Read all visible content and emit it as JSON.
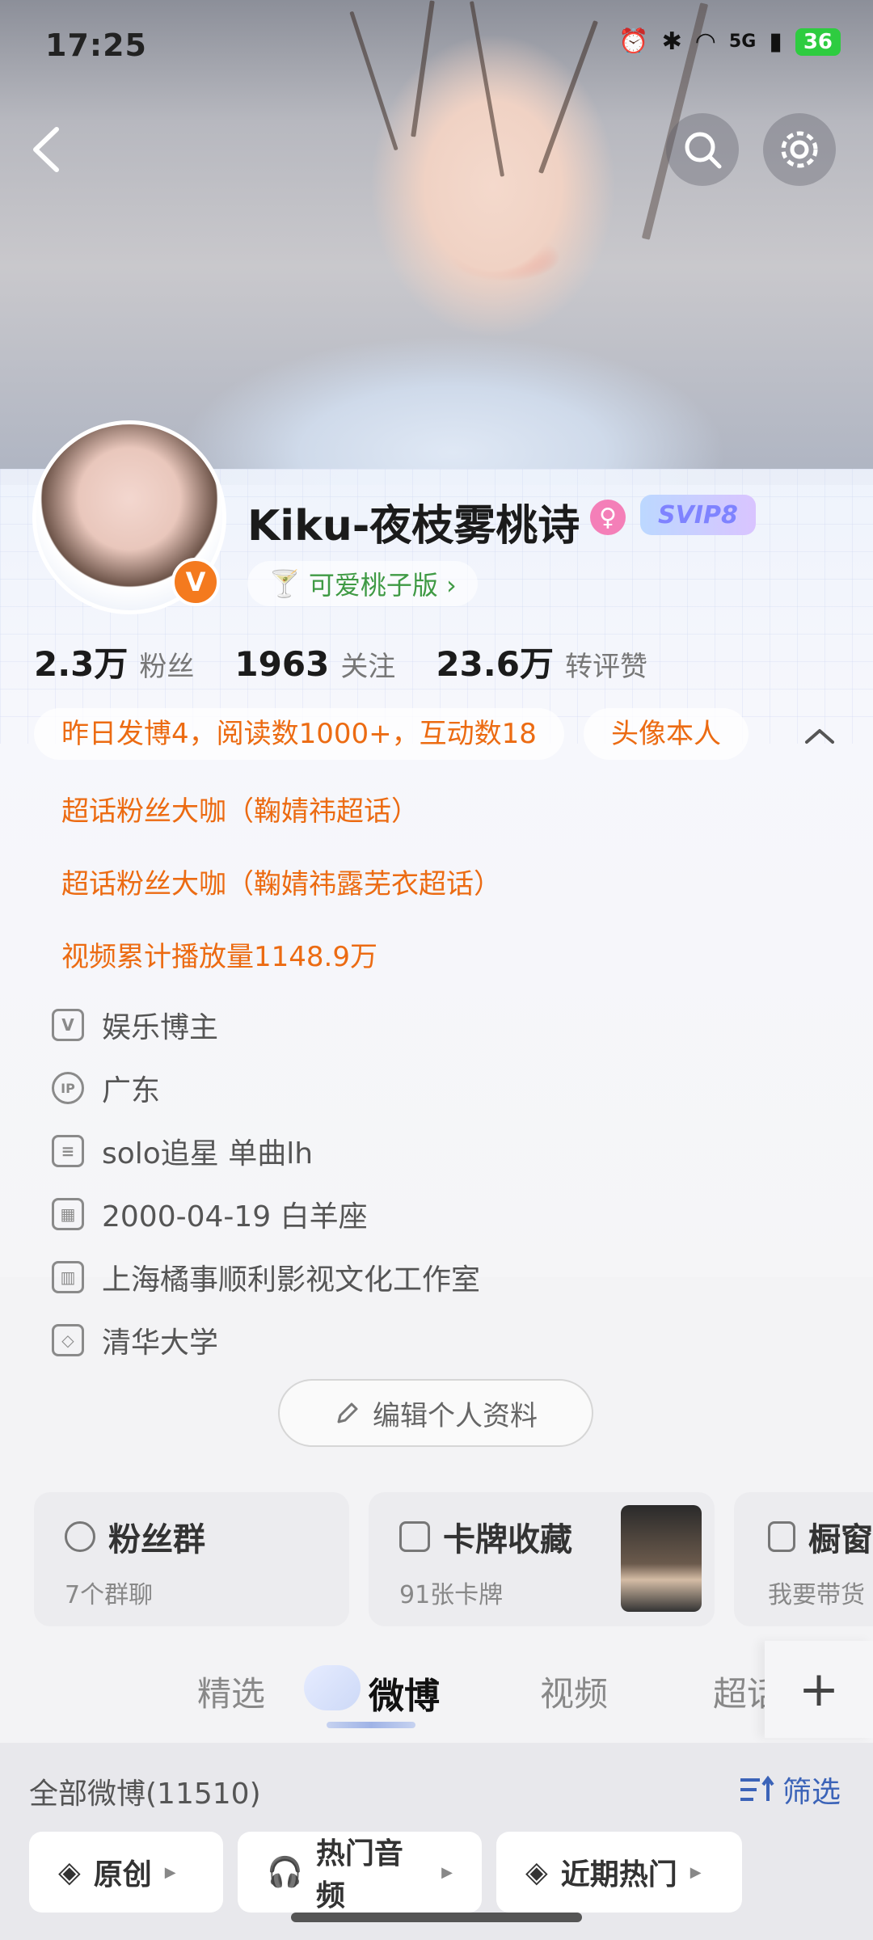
{
  "status_bar": {
    "time": "17:25",
    "network": "5G",
    "battery": "36"
  },
  "header": {
    "back_icon": "chevron-left-icon",
    "search_icon": "search-icon",
    "settings_icon": "gear-icon"
  },
  "profile": {
    "username": "Kiku-夜枝雾桃诗",
    "vip_label": "SVIP8",
    "verified_badge": "V",
    "fan_version_label": "可爱桃子版 ›"
  },
  "stats": [
    {
      "value": "2.3万",
      "label": "粉丝"
    },
    {
      "value": "1963",
      "label": "关注"
    },
    {
      "value": "23.6万",
      "label": "转评赞"
    }
  ],
  "highlights": {
    "pill_1": "昨日发博4，阅读数1000+，互动数18",
    "pill_2": "头像本人",
    "line_1": "超话粉丝大咖（鞠婧祎超话）",
    "line_2": "超话粉丝大咖（鞠婧祎露芜衣超话）",
    "line_3": "视频累计播放量1148.9万"
  },
  "info": [
    {
      "icon": "shield-v-icon",
      "glyph": "V",
      "text": "娱乐博主"
    },
    {
      "icon": "ip-icon",
      "glyph": "IP",
      "text": "广东"
    },
    {
      "icon": "document-icon",
      "glyph": "≡",
      "text": "solo追星  单曲lh"
    },
    {
      "icon": "calendar-icon",
      "glyph": "▦",
      "text": "2000-04-19 白羊座"
    },
    {
      "icon": "building-icon",
      "glyph": "▥",
      "text": "上海橘事顺利影视文化工作室"
    },
    {
      "icon": "graduation-cap-icon",
      "glyph": "◇",
      "text": "清华大学"
    }
  ],
  "edit_profile_label": "编辑个人资料",
  "cards": [
    {
      "title": "粉丝群",
      "subtitle": "7个群聊"
    },
    {
      "title": "卡牌收藏",
      "subtitle": "91张卡牌"
    },
    {
      "title": "橱窗",
      "subtitle": "我要带货"
    }
  ],
  "tabs": [
    "精选",
    "微博",
    "视频",
    "超话"
  ],
  "active_tab": "微博",
  "feed": {
    "all_posts_label": "全部微博(11510)",
    "filter_label": "筛选",
    "chips": [
      "原创",
      "热门音频",
      "近期热门"
    ]
  },
  "colors": {
    "accent_orange": "#ec6b12",
    "link_blue": "#3b63b8",
    "green": "#3f9a44"
  }
}
